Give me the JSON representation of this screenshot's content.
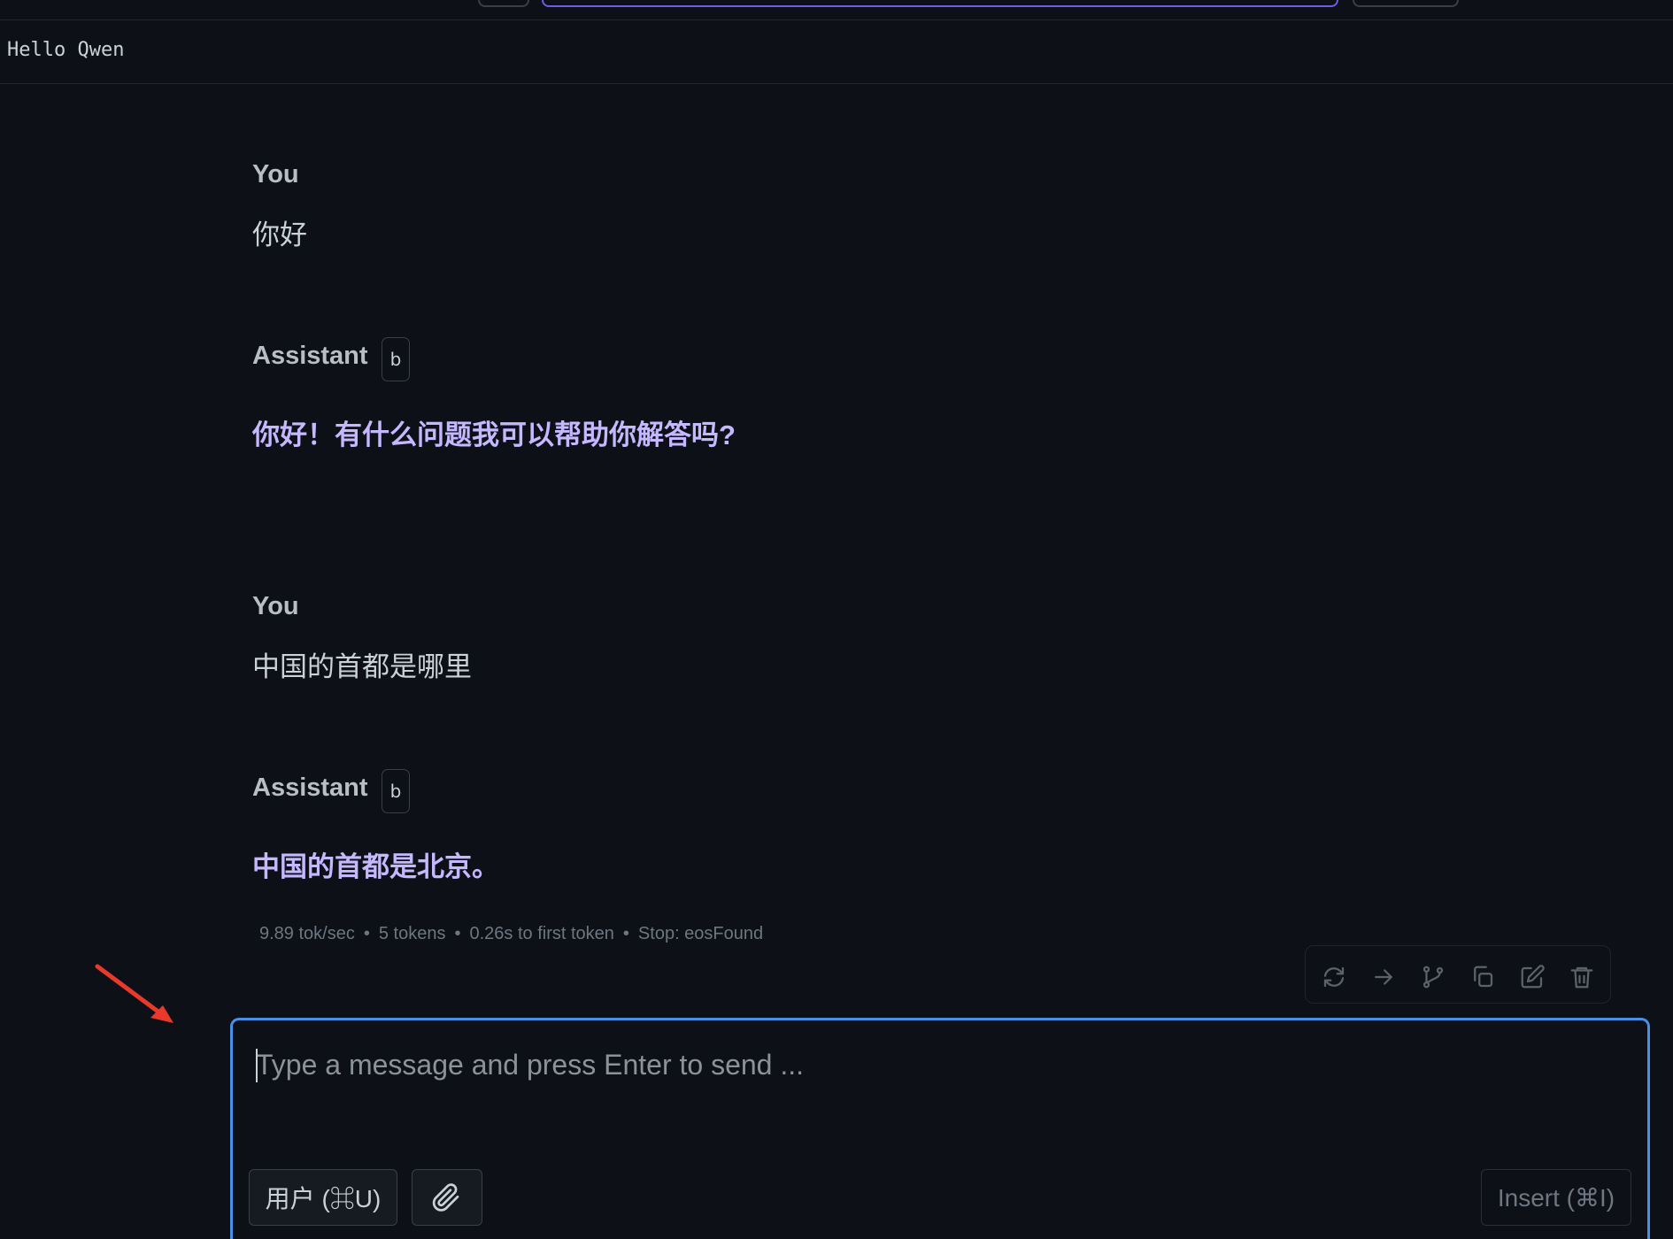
{
  "chat": {
    "title": "Hello Qwen"
  },
  "messages": [
    {
      "role": "You",
      "text": "你好"
    },
    {
      "role": "Assistant",
      "badge": "b",
      "text": "你好！有什么问题我可以帮助你解答吗?"
    },
    {
      "role": "You",
      "text": "中国的首都是哪里"
    },
    {
      "role": "Assistant",
      "badge": "b",
      "text": "中国的首都是北京。"
    }
  ],
  "stats": {
    "speed": "9.89 tok/sec",
    "tokens": "5 tokens",
    "first_token": "0.26s to first token",
    "stop": "Stop: eosFound",
    "separator": "•"
  },
  "toolbar_icons": [
    "regenerate-icon",
    "continue-arrow-icon",
    "branch-icon",
    "copy-icon",
    "edit-icon",
    "trash-icon"
  ],
  "composer": {
    "placeholder": "Type a message and press Enter to send ...",
    "role_button": "用户 (⌘U)",
    "attach_icon": "paperclip-icon",
    "insert_button": "Insert (⌘I)"
  },
  "colors": {
    "background": "#0d1117",
    "assistant_text": "#c5b8ff",
    "composer_border": "#4a8fe7",
    "annotation_arrow": "#e8392b"
  }
}
